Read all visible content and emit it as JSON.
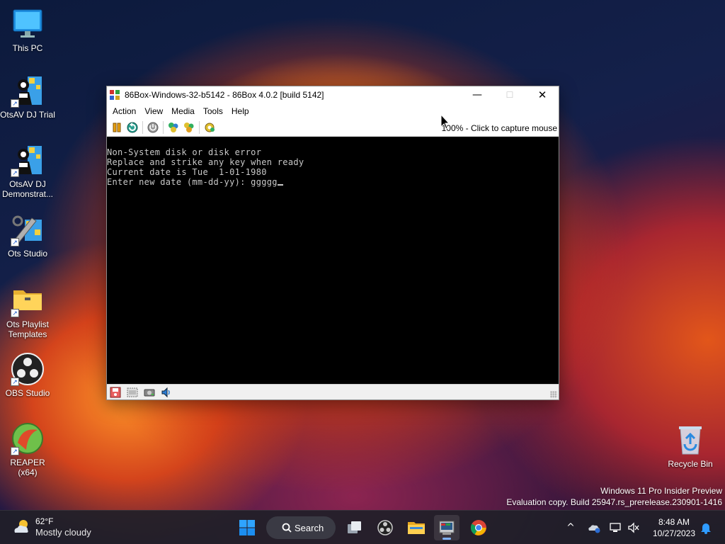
{
  "desktop": {
    "icons": [
      {
        "label": "This PC",
        "icon": "monitor-icon"
      },
      {
        "label": "OtsAV DJ Trial",
        "icon": "otsav-icon"
      },
      {
        "label": "OtsAV DJ Demonstrat...",
        "icon": "otsav-icon"
      },
      {
        "label": "Ots Studio",
        "icon": "ots-studio-icon"
      },
      {
        "label": "Ots Playlist Templates",
        "icon": "folder-icon"
      },
      {
        "label": "OBS Studio",
        "icon": "obs-icon"
      },
      {
        "label": "REAPER (x64)",
        "icon": "reaper-icon"
      },
      {
        "label": "Recycle Bin",
        "icon": "recycle-bin-icon"
      }
    ],
    "watermark": {
      "line1": "Windows 11 Pro Insider Preview",
      "line2": "Evaluation copy. Build 25947.rs_prerelease.230901-1416"
    }
  },
  "window": {
    "title": "86Box-Windows-32-b5142 - 86Box 4.0.2 [build 5142]",
    "controls": {
      "minimize": "—",
      "maximize": "☐",
      "close": "✕"
    },
    "menu": [
      "Action",
      "View",
      "Media",
      "Tools",
      "Help"
    ],
    "toolbar_status": "100% - Click to capture mouse",
    "screen_lines": [
      "Non-System disk or disk error",
      "Replace and strike any key when ready",
      "Current date is Tue  1-01-1980",
      "Enter new date (mm-dd-yy): ggggg"
    ]
  },
  "taskbar": {
    "weather": {
      "temp": "62°F",
      "condition": "Mostly cloudy"
    },
    "search_label": "Search",
    "clock": {
      "time": "8:48 AM",
      "date": "10/27/2023"
    },
    "tray_chevron": "^"
  },
  "colors": {
    "accent": "#7fb2ff",
    "screen_bg": "#000000",
    "screen_text": "#c8c8c8"
  }
}
